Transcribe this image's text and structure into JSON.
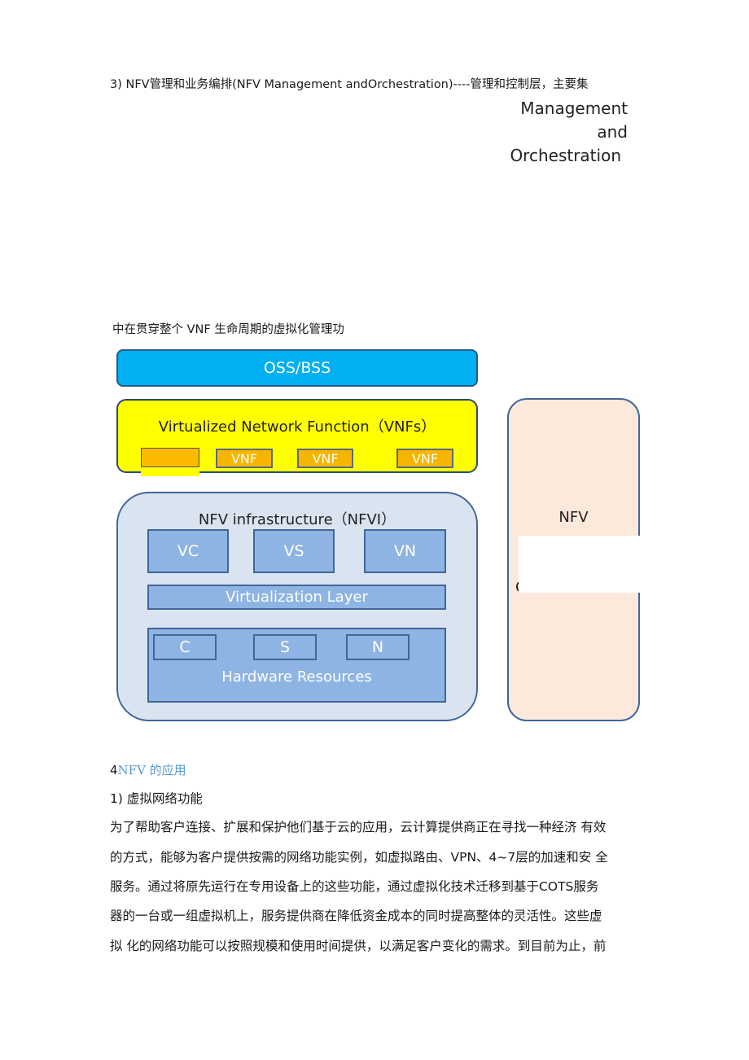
{
  "intro": {
    "line1": "3)  NFV管理和业务编排(NFV Management andOrchestration)----管理和控制层，主要集",
    "floating_label": [
      "Management",
      "and",
      "Orchestration"
    ],
    "line2": "中在贯穿整个  VNF 生命周期的虚拟化管理功"
  },
  "diagram": {
    "oss": "OSS/BSS",
    "vnfs_title": "Virtualized Network Function（VNFs）",
    "vnf_labels": [
      "VNF",
      "VNF",
      "VNF"
    ],
    "nfvi_title": "NFV  infrastructure（NFVI）",
    "virtual_resources": [
      "VC",
      "VS",
      "VN"
    ],
    "virtualization_layer": "Virtualization  Layer",
    "hardware_resources": [
      "C",
      "S",
      "N"
    ],
    "hardware_title": "Hardware   Resources",
    "mano_title": "NFV",
    "mano_partial": "Orchestration",
    "colors": {
      "oss": "#00b0f0",
      "vnfs": "#ffff00",
      "vnf": "#f7b500",
      "nfvi": "#dae3f0",
      "blue_box": "#8eb4e3",
      "mano": "#fde9dc"
    }
  },
  "section": {
    "heading_num": "4",
    "heading_text": "NFV 的应用",
    "sub": "1) 虚拟网络功能",
    "paragraph": [
      "为了帮助客户连接、扩展和保护他们基于云的应用，云计算提供商正在寻找一种经济  有效",
      "的方式，能够为客户提供按需的网络功能实例，如虚拟路由、VPN、4~7层的加速和安  全",
      "服务。通过将原先运行在专用设备上的这些功能，通过虚拟化技术迁移到基于COTS服务",
      "器的一台或一组虚拟机上，服务提供商在降低资金成本的同时提高整体的灵活性。这些虚",
      "拟  化的网络功能可以按照规模和使用时间提供，以满足客户变化的需求。到目前为止，前"
    ]
  }
}
